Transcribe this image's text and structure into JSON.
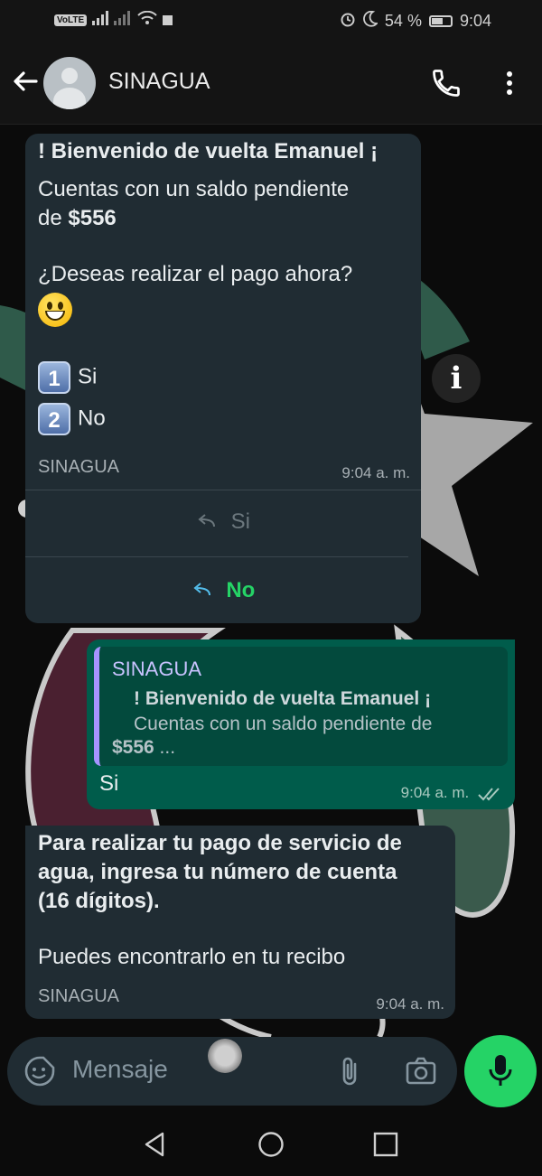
{
  "status_bar": {
    "volte": "VoLTE",
    "battery_text": "54 %",
    "time": "9:04",
    "battery_level": 0.54
  },
  "header": {
    "title": "SINAGUA"
  },
  "messages": {
    "m1": {
      "greeting": "! Bienvenido de vuelta Emanuel ¡",
      "line1": "Cuentas con un saldo pendiente",
      "line2_prefix": "de ",
      "amount": "$556",
      "question": "¿Deseas realizar el pago ahora?",
      "option1_num": "1",
      "option1": "Si",
      "option2_num": "2",
      "option2": "No",
      "sender": "SINAGUA",
      "time": "9:04 a. m.",
      "reply_si": "Si",
      "reply_no": "No"
    },
    "m2": {
      "quote_sender": "SINAGUA",
      "quote_line1": "! Bienvenido de vuelta Emanuel ¡",
      "quote_line2": "Cuentas con un saldo pendiente de",
      "quote_amount": "$556",
      "quote_ellipsis": " ...",
      "text": "Si",
      "time": "9:04 a. m."
    },
    "m3": {
      "line1": "Para realizar tu pago de servicio de",
      "line2": "agua, ingresa tu número de cuenta",
      "line3": "(16 dígitos).",
      "line4": "Puedes encontrarlo en tu recibo",
      "sender": "SINAGUA",
      "time": "9:04 a. m."
    }
  },
  "info_badge": "i",
  "composer": {
    "placeholder": "Mensaje"
  },
  "colors": {
    "incoming_bubble": "#202c33",
    "outgoing_bubble": "#005c4b",
    "accent_green": "#25d366",
    "quote_bar": "#a593ff"
  }
}
